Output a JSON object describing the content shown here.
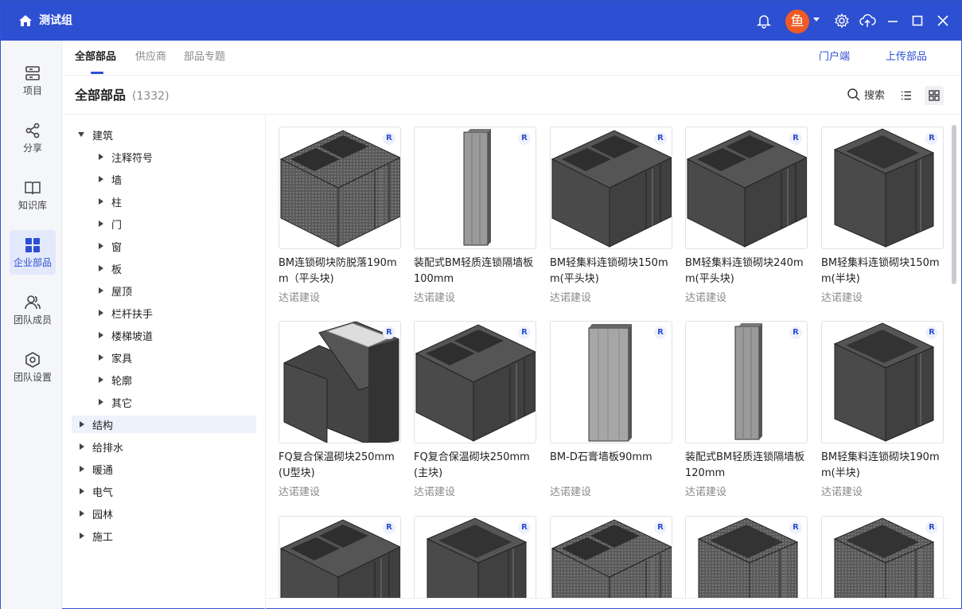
{
  "window": {
    "title": "测试组",
    "avatar_text": "鱼"
  },
  "sidebar": {
    "items": [
      {
        "label": "项目",
        "icon": "server-icon"
      },
      {
        "label": "分享",
        "icon": "share-icon"
      },
      {
        "label": "知识库",
        "icon": "book-icon"
      },
      {
        "label": "企业部品",
        "icon": "grid-icon"
      },
      {
        "label": "团队成员",
        "icon": "team-icon"
      },
      {
        "label": "团队设置",
        "icon": "hexagon-settings-icon"
      }
    ],
    "active_index": 3
  },
  "tabs": [
    {
      "label": "全部部品",
      "active": true
    },
    {
      "label": "供应商",
      "active": false
    },
    {
      "label": "部品专题",
      "active": false
    }
  ],
  "top_links": {
    "portal": "门户端",
    "upload": "上传部品"
  },
  "header": {
    "title": "全部部品",
    "count": "(1332)",
    "search_label": "搜索"
  },
  "tree": {
    "root": {
      "label": "建筑",
      "expanded": true,
      "children": [
        "注释符号",
        "墙",
        "柱",
        "门",
        "窗",
        "板",
        "屋顶",
        "栏杆扶手",
        "楼梯坡道",
        "家具",
        "轮廓",
        "其它"
      ]
    },
    "others": [
      {
        "label": "结构",
        "highlighted": true
      },
      {
        "label": "给排水"
      },
      {
        "label": "暖通"
      },
      {
        "label": "电气"
      },
      {
        "label": "园林"
      },
      {
        "label": "施工"
      }
    ]
  },
  "badge": "R",
  "cards": [
    {
      "name": "BM连锁砌块防脱落190mm（平头块)",
      "supplier": "达诺建设",
      "shape": "block2",
      "textured": true
    },
    {
      "name": "装配式BM轻质连锁隔墙板100mm",
      "supplier": "达诺建设",
      "shape": "panel",
      "textured": false
    },
    {
      "name": "BM轻集料连锁砌块150mm(平头块)",
      "supplier": "达诺建设",
      "shape": "block2",
      "textured": false
    },
    {
      "name": "BM轻集料连锁砌块240mm(平头块)",
      "supplier": "达诺建设",
      "shape": "block2",
      "textured": false
    },
    {
      "name": "BM轻集料连锁砌块150mm(半块)",
      "supplier": "达诺建设",
      "shape": "half",
      "textured": false
    },
    {
      "name": "FQ复合保温砌块250mm(U型块)",
      "supplier": "达诺建设",
      "shape": "ublock",
      "textured": false
    },
    {
      "name": "FQ复合保温砌块250mm(主块)",
      "supplier": "达诺建设",
      "shape": "block2",
      "textured": false
    },
    {
      "name": "BM-D石膏墙板90mm",
      "supplier": "达诺建设",
      "shape": "widepanel",
      "textured": false
    },
    {
      "name": "装配式BM轻质连锁隔墙板120mm",
      "supplier": "达诺建设",
      "shape": "panel",
      "textured": false
    },
    {
      "name": "BM轻集料连锁砌块190mm(半块)",
      "supplier": "达诺建设",
      "shape": "half",
      "textured": false
    },
    {
      "name": "",
      "supplier": "",
      "shape": "block2",
      "textured": false
    },
    {
      "name": "",
      "supplier": "",
      "shape": "half",
      "textured": false
    },
    {
      "name": "",
      "supplier": "",
      "shape": "block2",
      "textured": true
    },
    {
      "name": "",
      "supplier": "",
      "shape": "half",
      "textured": true
    },
    {
      "name": "",
      "supplier": "",
      "shape": "half",
      "textured": true
    }
  ],
  "colors": {
    "brand": "#2d4fd1",
    "avatar": "#f15a24",
    "block": "#4a4a4a"
  }
}
